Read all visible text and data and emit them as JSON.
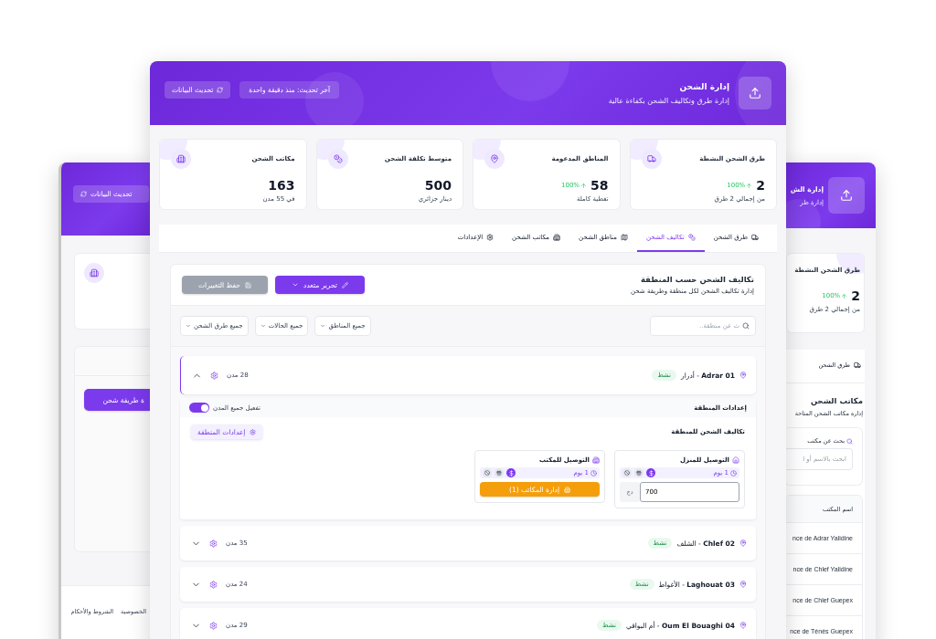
{
  "back_left_window": {
    "refresh_button": "تحديث البيانات",
    "add_button": "ة طريقة شحن",
    "footer_links": [
      "الخصوصية",
      "الشروط والأحكام"
    ]
  },
  "back_right_window": {
    "title": "إدارة الش",
    "subtitle": "إدارة طر",
    "stat": {
      "title": "طرق الشحن النشطة",
      "value": "2",
      "trend": "100%",
      "note": "من إجمالي 2 طرق"
    },
    "tab": "طرق الشحن",
    "section_title": "مكاتب الشحن",
    "section_subtitle": "إدارة مكاتب الشحن المتاحة",
    "search_label": "بحث عن مكتب",
    "search_placeholder": "ابحث بالاسم أو ا",
    "table": {
      "columns": [
        "اسم المكتب"
      ],
      "rows": [
        "nce de Adrar Yalidine",
        "nce de Chlef Yalidine",
        "nce de Chlef Guepex",
        "nce de Ténès Guepex"
      ]
    }
  },
  "main_window": {
    "title": "إدارة الشحن",
    "subtitle": "إدارة طرق وتكاليف الشحن بكفاءة عالية",
    "last_update": "آخر تحديث: منذ دقيقة واحدة",
    "refresh_button": "تحديث البيانات",
    "stats": [
      {
        "kind": "routes",
        "title": "طرق الشحن النشطة",
        "value": "2",
        "trend": "100%",
        "note": "من إجمالي 2 طرق"
      },
      {
        "kind": "regions",
        "title": "المناطق المدعومة",
        "value": "58",
        "trend": "100%",
        "note": "تغطية كاملة"
      },
      {
        "kind": "cost",
        "title": "متوسط تكلفة الشحن",
        "value": "500",
        "note": "دينار جزائري"
      },
      {
        "kind": "offices",
        "title": "مكاتب الشحن",
        "value": "163",
        "note": "في 55 مدن"
      }
    ],
    "tabs": [
      {
        "kind": "routes",
        "label": "طرق الشحن",
        "selected": false
      },
      {
        "kind": "cost",
        "label": "تكاليف الشحن",
        "selected": true
      },
      {
        "kind": "regions",
        "label": "مناطق الشحن",
        "selected": false
      },
      {
        "kind": "offices",
        "label": "مكاتب الشحن",
        "selected": false
      },
      {
        "kind": "settings",
        "label": "الإعدادات",
        "selected": false
      }
    ],
    "panel": {
      "title": "تكاليف الشحن حسب المنطقة",
      "subtitle": "إدارة تكاليف الشحن لكل منطقة وطريقة شحن",
      "edit_button": "تحرير متعدد",
      "save_button": {
        "label": "حفظ التغييرات",
        "disabled": true
      },
      "search_placeholder": "ث عن منطقة..",
      "filters": [
        "جميع المناطق",
        "جميع الحالات",
        "جميع طرق الشحن"
      ],
      "regions": [
        {
          "name": "**01 Adrar** - أدرار",
          "status": "نشط",
          "cities": "28 مدن",
          "expanded": true,
          "details": {
            "settings_title": "إعدادات المنطقة",
            "toggle": {
              "label": "تفعيل جميع المدن",
              "on": true
            },
            "costs_title": "تكاليف الشحن للمنطقة",
            "settings_button": "إعدادات المنطقة",
            "methods": [
              {
                "kind": "home",
                "title": "التوصيل للمنزل",
                "duration": "1 يوم",
                "price": "700",
                "currency": "دج"
              },
              {
                "kind": "office",
                "title": "التوصيل للمكتب",
                "duration": "1 يوم",
                "button": "إدارة المكاتب (1)"
              }
            ]
          }
        },
        {
          "name": "**02 Chlef** - الشلف",
          "status": "نشط",
          "cities": "35 مدن",
          "expanded": false
        },
        {
          "name": "**03 Laghouat** - الأغواط",
          "status": "نشط",
          "cities": "24 مدن",
          "expanded": false
        },
        {
          "name": "**04 Oum El Bouaghi** - أم البواقي",
          "status": "نشط",
          "cities": "29 مدن",
          "expanded": false
        }
      ]
    }
  }
}
